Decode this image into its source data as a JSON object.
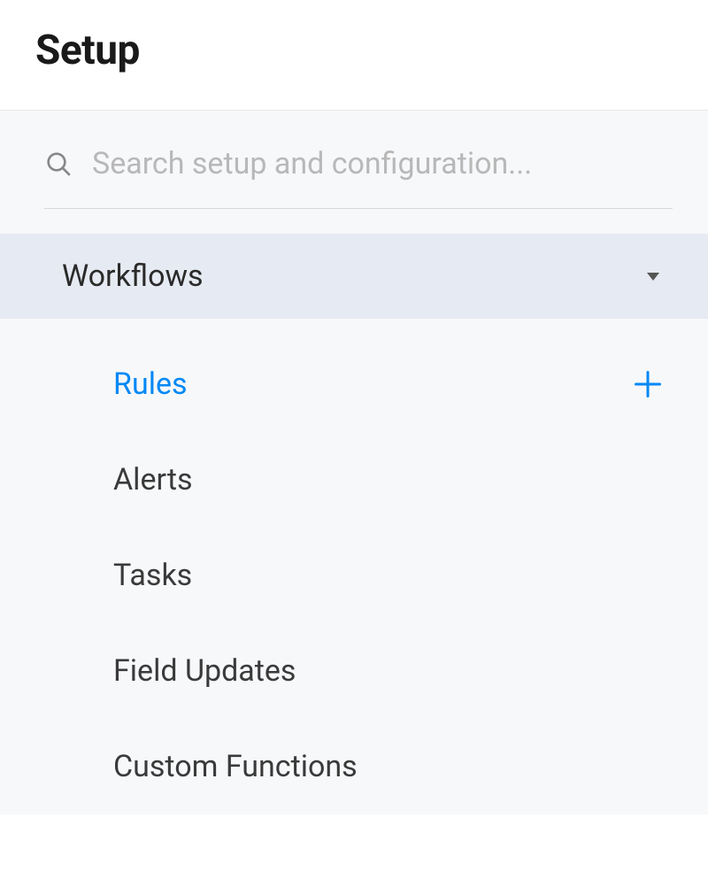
{
  "header": {
    "title": "Setup"
  },
  "search": {
    "placeholder": "Search setup and configuration..."
  },
  "section": {
    "title": "Workflows"
  },
  "menu": {
    "items": [
      {
        "label": "Rules",
        "active": true,
        "has_add": true
      },
      {
        "label": "Alerts",
        "active": false,
        "has_add": false
      },
      {
        "label": "Tasks",
        "active": false,
        "has_add": false
      },
      {
        "label": "Field Updates",
        "active": false,
        "has_add": false
      },
      {
        "label": "Custom Functions",
        "active": false,
        "has_add": false
      }
    ]
  },
  "colors": {
    "accent": "#0288f5"
  }
}
